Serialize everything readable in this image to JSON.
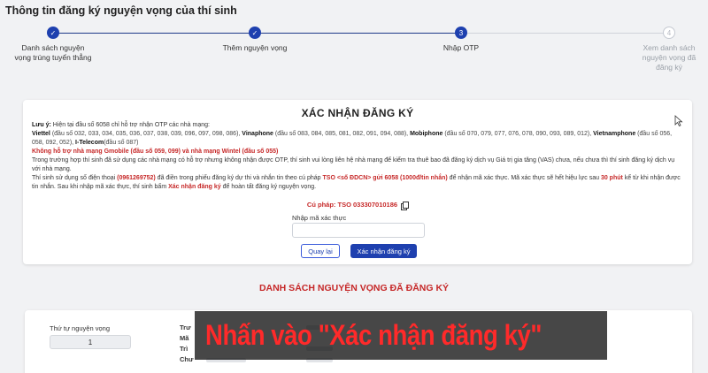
{
  "header": {
    "title": "Thông tin đăng ký nguyện vọng của thí sinh"
  },
  "steps": [
    {
      "label": "Danh sách nguyện vọng trúng tuyển thẳng",
      "state": "done",
      "marker": "✓"
    },
    {
      "label": "Thêm nguyện vọng",
      "state": "done",
      "marker": "✓"
    },
    {
      "label": "Nhập OTP",
      "state": "active",
      "marker": "3"
    },
    {
      "label": "Xem danh sách nguyện vọng đã đăng ký",
      "state": "pending",
      "marker": "4"
    }
  ],
  "confirm": {
    "title": "XÁC NHẬN ĐĂNG KÝ",
    "note_prefix": "Lưu ý:",
    "note_text": " Hiện tại đầu số 6058 chỉ hỗ trợ nhận OTP các nhà mạng:",
    "carriers": [
      {
        "name": "Viettel",
        "numbers": " (đầu số 032, 033, 034, 035, 036, 037, 038, 039, 096, 097, 098, 086), "
      },
      {
        "name": "Vinaphone",
        "numbers": " (đầu số 083, 084, 085, 081, 082, 091, 094, 088), "
      },
      {
        "name": "Mobiphone",
        "numbers": " (đầu số 070, 079, 077, 076, 078, 090, 093, 089, 012), "
      },
      {
        "name": "Vietnamphone",
        "numbers": " (đầu số 056, 058, 092, 052), "
      },
      {
        "name": "I-Telecom",
        "numbers": "(đầu số 087)"
      }
    ],
    "unsupported": "Không hỗ trợ nhà mạng Gmobile (đầu số 059, 099) và nhà mạng Wintel (đầu số 055)",
    "unsupported_note": "Trong trường hợp thí sinh đã sử dụng các nhà mạng có hỗ trợ nhưng không nhận được OTP, thí sinh vui lòng liên hệ nhà mạng để kiểm tra thuê bao đã đăng ký dịch vụ Giá trị gia tăng (VAS) chưa, nếu chưa thì thí sinh đăng ký dịch vụ với nhà mạng.",
    "phone_sentence_1": "Thí sinh sử dụng số điện thoại ",
    "phone": "(0961269752)",
    "phone_sentence_2": " đã điền trong phiếu đăng ký dự thi và nhắn tin theo cú pháp ",
    "sms_syntax": "TSO <số ĐDCN> gửi 6058 (1000đ/tin nhắn)",
    "phone_sentence_3": " để nhận mã xác thực. Mã xác thực sẽ hết hiệu lực sau ",
    "expire": "30 phút",
    "phone_sentence_4": " kể từ khi nhận được tin nhắn. Sau khi nhập mã xác thực, thí sinh bấm ",
    "confirm_phrase": "Xác nhận đăng ký",
    "phone_sentence_5": " để hoàn tất đăng ký nguyện vọng.",
    "syntax_line": "Cú pháp: TSO 033307010186",
    "otp_label": "Nhập mã xác thực",
    "otp_value": "",
    "back_label": "Quay lại",
    "confirm_label": "Xác nhận đăng ký"
  },
  "list": {
    "heading": "DANH SÁCH NGUYỆN VỌNG ĐÃ ĐĂNG KÝ",
    "order_label": "Thứ tự nguyện vọng",
    "order_value": "1",
    "field_stubs": [
      "Trư",
      "Mã",
      "Trì",
      "Chư"
    ]
  },
  "overlay": {
    "caption": "Nhấn vào \"Xác nhận đăng ký\""
  }
}
